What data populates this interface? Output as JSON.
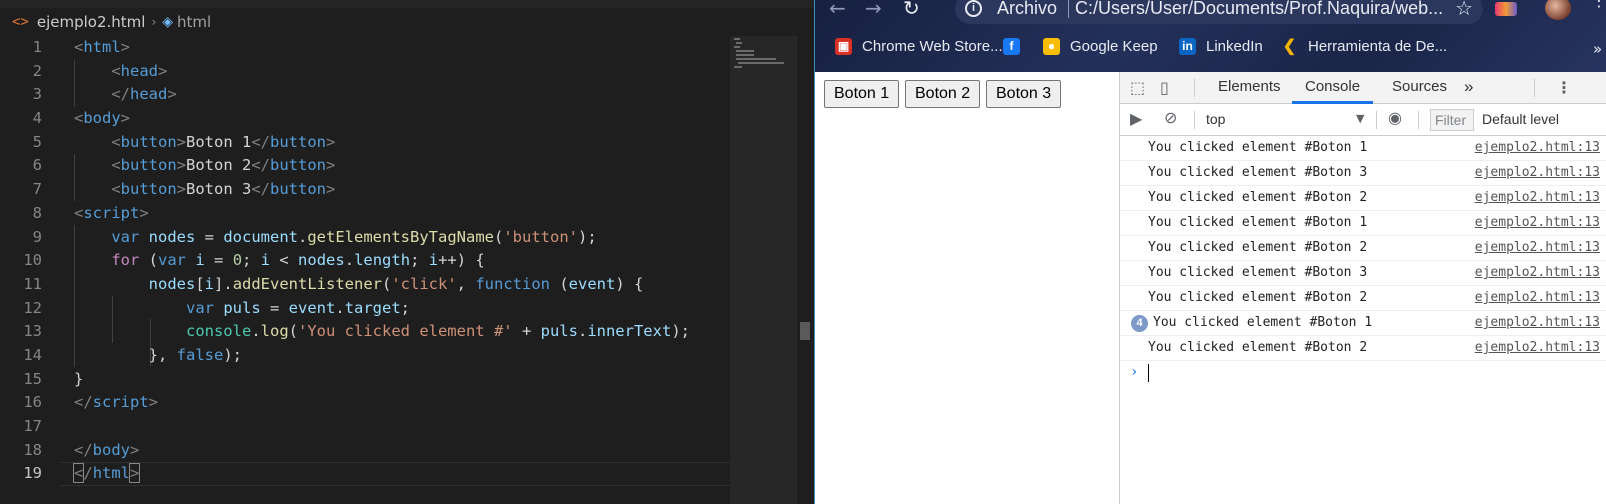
{
  "editor": {
    "breadcrumb": {
      "file": "ejemplo2.html",
      "symbol": "html"
    },
    "line_numbers": [
      "1",
      "2",
      "3",
      "4",
      "5",
      "6",
      "7",
      "8",
      "9",
      "10",
      "11",
      "12",
      "13",
      "14",
      "15",
      "16",
      "17",
      "18",
      "19"
    ],
    "current_line": 19
  },
  "browser": {
    "omnibox": {
      "chip": "Archivo",
      "url": "C:/Users/User/Documents/Prof.Naquira/web..."
    },
    "bookmarks": [
      {
        "label": "Chrome Web Store...",
        "icon": "chrome-web-store-icon",
        "color": "#d93025"
      },
      {
        "label": "",
        "icon": "facebook-icon",
        "color": "#1877f2"
      },
      {
        "label": "Google Keep",
        "icon": "google-keep-icon",
        "color": "#fbbc04"
      },
      {
        "label": "LinkedIn",
        "icon": "linkedin-icon",
        "color": "#0a66c2"
      },
      {
        "label": "Herramienta de De...",
        "icon": "devtools-bookmark-icon",
        "color": "#f4b400"
      }
    ],
    "page_buttons": [
      "Boton 1",
      "Boton 2",
      "Boton 3"
    ]
  },
  "devtools": {
    "tabs": [
      "Elements",
      "Console",
      "Sources"
    ],
    "active_tab": "Console",
    "more_tabs": "»",
    "context": "top",
    "filter_placeholder": "Filter",
    "level": "Default level",
    "messages": [
      {
        "text": "You clicked element #Boton 1",
        "source": "ejemplo2.html:13",
        "count": ""
      },
      {
        "text": "You clicked element #Boton 3",
        "source": "ejemplo2.html:13",
        "count": ""
      },
      {
        "text": "You clicked element #Boton 2",
        "source": "ejemplo2.html:13",
        "count": ""
      },
      {
        "text": "You clicked element #Boton 1",
        "source": "ejemplo2.html:13",
        "count": ""
      },
      {
        "text": "You clicked element #Boton 2",
        "source": "ejemplo2.html:13",
        "count": ""
      },
      {
        "text": "You clicked element #Boton 3",
        "source": "ejemplo2.html:13",
        "count": ""
      },
      {
        "text": "You clicked element #Boton 2",
        "source": "ejemplo2.html:13",
        "count": ""
      },
      {
        "text": "You clicked element #Boton 1",
        "source": "ejemplo2.html:13",
        "count": "4"
      },
      {
        "text": "You clicked element #Boton 2",
        "source": "ejemplo2.html:13",
        "count": ""
      }
    ],
    "prompt": "›"
  },
  "colors": {
    "editor_bg": "#1e1e1e",
    "tag": "#569cd6",
    "keyword": "#c586c0",
    "string": "#ce9178",
    "function": "#dcdcaa",
    "variable": "#9cdcfe",
    "number": "#b5cea8",
    "devtools_accent": "#1a73e8"
  }
}
